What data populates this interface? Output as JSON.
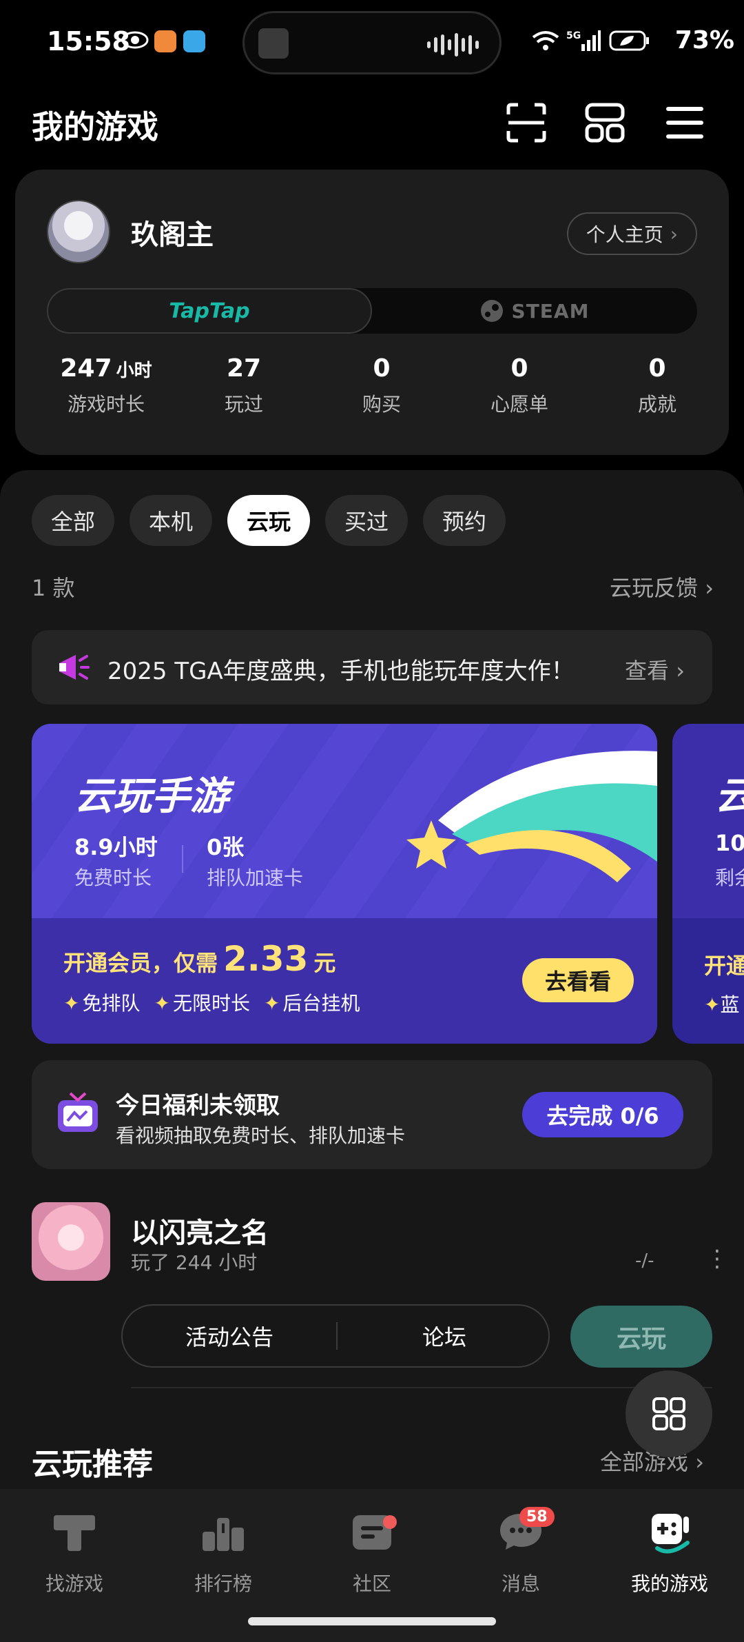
{
  "status_bar": {
    "time": "15:58",
    "battery": "73%"
  },
  "header": {
    "title": "我的游戏"
  },
  "profile": {
    "name": "玖阁主",
    "home_button": "个人主页",
    "platforms": [
      "TapTap",
      "STEAM"
    ],
    "stats": [
      {
        "value": "247",
        "unit": "小时",
        "label": "游戏时长"
      },
      {
        "value": "27",
        "unit": "",
        "label": "玩过"
      },
      {
        "value": "0",
        "unit": "",
        "label": "购买"
      },
      {
        "value": "0",
        "unit": "",
        "label": "心愿单"
      },
      {
        "value": "0",
        "unit": "",
        "label": "成就"
      }
    ]
  },
  "filters": [
    "全部",
    "本机",
    "云玩",
    "买过",
    "预约"
  ],
  "active_filter": "云玩",
  "list": {
    "count": "1 款",
    "feedback": "云玩反馈"
  },
  "announcement": {
    "text": "2025 TGA年度盛典，手机也能玩年度大作！",
    "more": "查看"
  },
  "promo": {
    "title": "云玩手游",
    "free_time_value": "8.9小时",
    "free_time_label": "免费时长",
    "card_value": "0张",
    "card_label": "排队加速卡",
    "price_prefix": "开通会员，仅需",
    "price": "2.33",
    "price_unit": "元",
    "perks": [
      "免排队",
      "无限时长",
      "后台挂机"
    ],
    "cta": "去看看"
  },
  "promo_peek": {
    "title": "云",
    "value": "10",
    "label": "剩余",
    "price": "开通",
    "perk": "蓝"
  },
  "task": {
    "title": "今日福利未领取",
    "subtitle": "看视频抽取免费时长、排队加速卡",
    "button": "去完成 0/6"
  },
  "game": {
    "name": "以闪亮之名",
    "played": "玩了 244 小时",
    "status": "-/-",
    "actions": [
      "活动公告",
      "论坛"
    ],
    "play_button": "云玩"
  },
  "recommend": {
    "title": "云玩推荐",
    "all": "全部游戏"
  },
  "nav": {
    "items": [
      {
        "label": "找游戏",
        "icon": "t-logo-icon"
      },
      {
        "label": "排行榜",
        "icon": "ranking-icon"
      },
      {
        "label": "社区",
        "icon": "community-icon"
      },
      {
        "label": "消息",
        "icon": "message-icon"
      },
      {
        "label": "我的游戏",
        "icon": "gamepad-icon"
      }
    ],
    "message_badge": "58"
  },
  "colors": {
    "accent_teal": "#19b9a7",
    "promo_purple": "#4c40c6",
    "promo_yellow": "#ffe06a",
    "badge_red": "#ef4b4b"
  }
}
